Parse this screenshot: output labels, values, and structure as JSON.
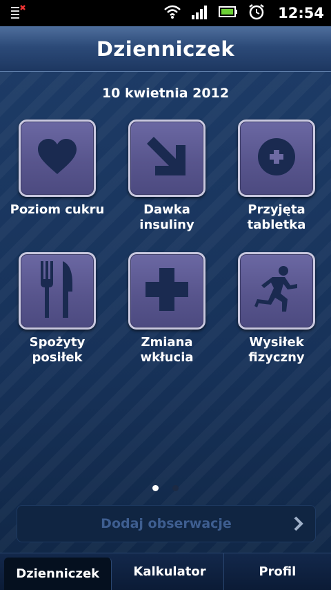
{
  "status_bar": {
    "time": "12:54",
    "icons": [
      "notification-icon",
      "wifi-icon",
      "signal-icon",
      "battery-icon",
      "alarm-icon"
    ]
  },
  "header": {
    "title": "Dzienniczek"
  },
  "main": {
    "date": "10 kwietnia 2012",
    "tiles": [
      {
        "label": "Poziom cukru",
        "icon": "heart-icon"
      },
      {
        "label": "Dawka insuliny",
        "icon": "arrow-down-right-icon"
      },
      {
        "label": "Przyjęta tabletka",
        "icon": "pill-icon"
      },
      {
        "label": "Spożyty posiłek",
        "icon": "fork-knife-icon"
      },
      {
        "label": "Zmiana wkłucia",
        "icon": "cross-icon"
      },
      {
        "label": "Wysiłek fizyczny",
        "icon": "runner-icon"
      }
    ],
    "page_indicator": {
      "current": 1,
      "total": 2
    },
    "add_button": "Dodaj obserwacje"
  },
  "tabs": [
    {
      "label": "Dzienniczek",
      "active": true
    },
    {
      "label": "Kalkulator",
      "active": false
    },
    {
      "label": "Profil",
      "active": false
    }
  ],
  "colors": {
    "tile_fill": "#5a578f",
    "tile_border": "#c9c8df",
    "icon_fill": "#1a2a50",
    "background": "#173259"
  }
}
